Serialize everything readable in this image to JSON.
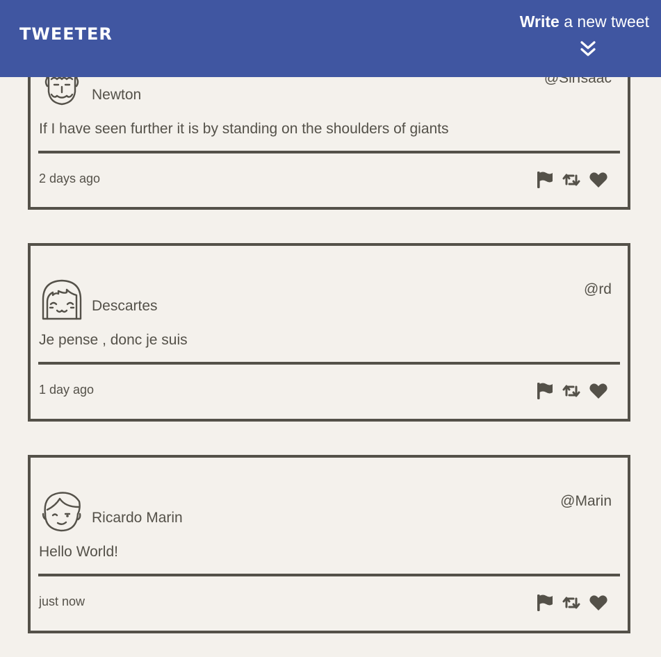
{
  "nav": {
    "brand": "TWEETER",
    "compose_strong": "Write",
    "compose_rest": " a new tweet"
  },
  "tweets": [
    {
      "name": "Newton",
      "handle": "@SirIsaac",
      "text": "If I have seen further it is by standing on the shoulders of giants",
      "time": "2 days ago",
      "avatar": "curly-hair-face-icon"
    },
    {
      "name": "Descartes",
      "handle": "@rd",
      "text": "Je pense , donc je suis",
      "time": "1 day ago",
      "avatar": "bob-hair-face-icon"
    },
    {
      "name": "Ricardo Marin",
      "handle": "@Marin",
      "text": "Hello World!",
      "time": "just now",
      "avatar": "winking-face-icon"
    }
  ],
  "actions": [
    "flag-icon",
    "retweet-icon",
    "heart-icon"
  ],
  "colors": {
    "nav_bg": "#4056a1",
    "page_bg": "#f4f1ec",
    "ink": "#545149"
  }
}
